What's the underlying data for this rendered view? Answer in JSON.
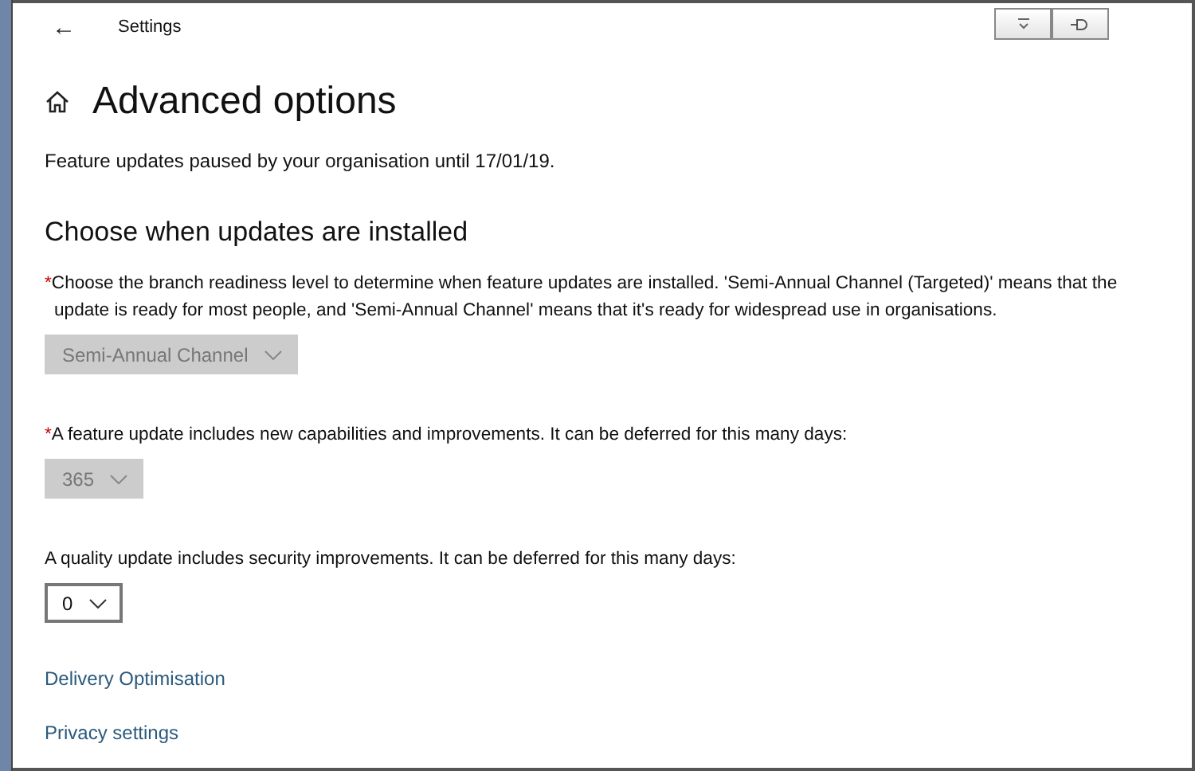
{
  "window": {
    "title": "Settings",
    "back_icon": "←"
  },
  "page": {
    "title": "Advanced options",
    "notice": "Feature updates paused by your organisation until 17/01/19."
  },
  "section": {
    "title": "Choose when updates are installed"
  },
  "settings": [
    {
      "required_mark": "*",
      "label": "Choose the branch readiness level to determine when feature updates are installed. 'Semi-Annual Channel (Targeted)' means that the update is ready for most people, and 'Semi-Annual Channel' means that it's ready for widespread use in organisations.",
      "value": "Semi-Annual Channel",
      "disabled": true
    },
    {
      "required_mark": "*",
      "label": "A feature update includes new capabilities and improvements. It can be deferred for this many days:",
      "value": "365",
      "disabled": true
    },
    {
      "label": "A quality update includes security improvements. It can be deferred for this many days:",
      "value": "0",
      "disabled": false
    }
  ],
  "links": [
    "Delivery Optimisation",
    "Privacy settings"
  ]
}
